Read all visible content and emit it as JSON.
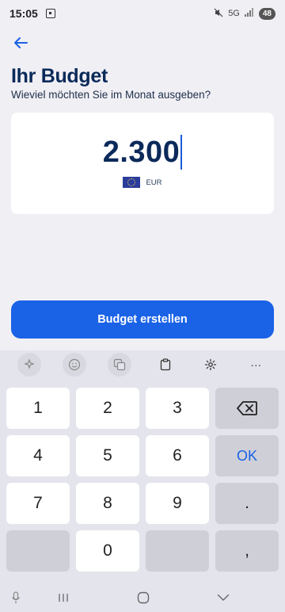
{
  "status_bar": {
    "time": "15:05",
    "network": "5G",
    "battery": "48"
  },
  "header": {
    "title": "Ihr Budget",
    "subtitle": "Wieviel möchten Sie im Monat ausgeben?"
  },
  "amount_card": {
    "amount": "2.300",
    "currency": "EUR"
  },
  "primary_button": {
    "label": "Budget erstellen"
  },
  "keyboard": {
    "keys": [
      "1",
      "2",
      "3",
      "4",
      "5",
      "6",
      "7",
      "8",
      "9",
      "0"
    ],
    "ok_label": "OK",
    "period": ".",
    "comma": ",",
    "more": "···"
  },
  "colors": {
    "accent": "#1a62e6",
    "title": "#0b2a5a"
  }
}
